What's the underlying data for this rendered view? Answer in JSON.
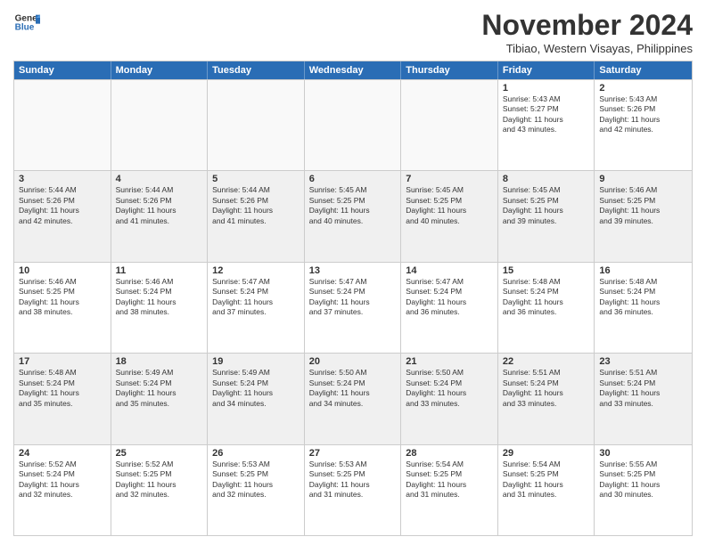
{
  "logo": {
    "line1": "General",
    "line2": "Blue"
  },
  "title": "November 2024",
  "subtitle": "Tibiao, Western Visayas, Philippines",
  "header_days": [
    "Sunday",
    "Monday",
    "Tuesday",
    "Wednesday",
    "Thursday",
    "Friday",
    "Saturday"
  ],
  "rows": [
    [
      {
        "day": "",
        "info": ""
      },
      {
        "day": "",
        "info": ""
      },
      {
        "day": "",
        "info": ""
      },
      {
        "day": "",
        "info": ""
      },
      {
        "day": "",
        "info": ""
      },
      {
        "day": "1",
        "info": "Sunrise: 5:43 AM\nSunset: 5:27 PM\nDaylight: 11 hours\nand 43 minutes."
      },
      {
        "day": "2",
        "info": "Sunrise: 5:43 AM\nSunset: 5:26 PM\nDaylight: 11 hours\nand 42 minutes."
      }
    ],
    [
      {
        "day": "3",
        "info": "Sunrise: 5:44 AM\nSunset: 5:26 PM\nDaylight: 11 hours\nand 42 minutes."
      },
      {
        "day": "4",
        "info": "Sunrise: 5:44 AM\nSunset: 5:26 PM\nDaylight: 11 hours\nand 41 minutes."
      },
      {
        "day": "5",
        "info": "Sunrise: 5:44 AM\nSunset: 5:26 PM\nDaylight: 11 hours\nand 41 minutes."
      },
      {
        "day": "6",
        "info": "Sunrise: 5:45 AM\nSunset: 5:25 PM\nDaylight: 11 hours\nand 40 minutes."
      },
      {
        "day": "7",
        "info": "Sunrise: 5:45 AM\nSunset: 5:25 PM\nDaylight: 11 hours\nand 40 minutes."
      },
      {
        "day": "8",
        "info": "Sunrise: 5:45 AM\nSunset: 5:25 PM\nDaylight: 11 hours\nand 39 minutes."
      },
      {
        "day": "9",
        "info": "Sunrise: 5:46 AM\nSunset: 5:25 PM\nDaylight: 11 hours\nand 39 minutes."
      }
    ],
    [
      {
        "day": "10",
        "info": "Sunrise: 5:46 AM\nSunset: 5:25 PM\nDaylight: 11 hours\nand 38 minutes."
      },
      {
        "day": "11",
        "info": "Sunrise: 5:46 AM\nSunset: 5:24 PM\nDaylight: 11 hours\nand 38 minutes."
      },
      {
        "day": "12",
        "info": "Sunrise: 5:47 AM\nSunset: 5:24 PM\nDaylight: 11 hours\nand 37 minutes."
      },
      {
        "day": "13",
        "info": "Sunrise: 5:47 AM\nSunset: 5:24 PM\nDaylight: 11 hours\nand 37 minutes."
      },
      {
        "day": "14",
        "info": "Sunrise: 5:47 AM\nSunset: 5:24 PM\nDaylight: 11 hours\nand 36 minutes."
      },
      {
        "day": "15",
        "info": "Sunrise: 5:48 AM\nSunset: 5:24 PM\nDaylight: 11 hours\nand 36 minutes."
      },
      {
        "day": "16",
        "info": "Sunrise: 5:48 AM\nSunset: 5:24 PM\nDaylight: 11 hours\nand 36 minutes."
      }
    ],
    [
      {
        "day": "17",
        "info": "Sunrise: 5:48 AM\nSunset: 5:24 PM\nDaylight: 11 hours\nand 35 minutes."
      },
      {
        "day": "18",
        "info": "Sunrise: 5:49 AM\nSunset: 5:24 PM\nDaylight: 11 hours\nand 35 minutes."
      },
      {
        "day": "19",
        "info": "Sunrise: 5:49 AM\nSunset: 5:24 PM\nDaylight: 11 hours\nand 34 minutes."
      },
      {
        "day": "20",
        "info": "Sunrise: 5:50 AM\nSunset: 5:24 PM\nDaylight: 11 hours\nand 34 minutes."
      },
      {
        "day": "21",
        "info": "Sunrise: 5:50 AM\nSunset: 5:24 PM\nDaylight: 11 hours\nand 33 minutes."
      },
      {
        "day": "22",
        "info": "Sunrise: 5:51 AM\nSunset: 5:24 PM\nDaylight: 11 hours\nand 33 minutes."
      },
      {
        "day": "23",
        "info": "Sunrise: 5:51 AM\nSunset: 5:24 PM\nDaylight: 11 hours\nand 33 minutes."
      }
    ],
    [
      {
        "day": "24",
        "info": "Sunrise: 5:52 AM\nSunset: 5:24 PM\nDaylight: 11 hours\nand 32 minutes."
      },
      {
        "day": "25",
        "info": "Sunrise: 5:52 AM\nSunset: 5:25 PM\nDaylight: 11 hours\nand 32 minutes."
      },
      {
        "day": "26",
        "info": "Sunrise: 5:53 AM\nSunset: 5:25 PM\nDaylight: 11 hours\nand 32 minutes."
      },
      {
        "day": "27",
        "info": "Sunrise: 5:53 AM\nSunset: 5:25 PM\nDaylight: 11 hours\nand 31 minutes."
      },
      {
        "day": "28",
        "info": "Sunrise: 5:54 AM\nSunset: 5:25 PM\nDaylight: 11 hours\nand 31 minutes."
      },
      {
        "day": "29",
        "info": "Sunrise: 5:54 AM\nSunset: 5:25 PM\nDaylight: 11 hours\nand 31 minutes."
      },
      {
        "day": "30",
        "info": "Sunrise: 5:55 AM\nSunset: 5:25 PM\nDaylight: 11 hours\nand 30 minutes."
      }
    ]
  ]
}
